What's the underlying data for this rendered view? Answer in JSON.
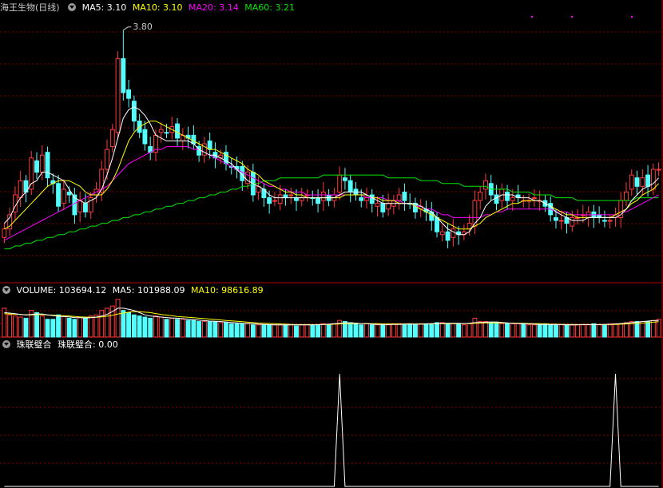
{
  "title": "海王生物(日线)",
  "colors": {
    "up": "#ff3c3c",
    "down": "#54ffff",
    "ma5": "#ffffff",
    "ma10": "#ffff00",
    "ma20": "#ff00ff",
    "ma60": "#00e600",
    "grid": "#8b0000",
    "signal": "#ffffff"
  },
  "price_panel": {
    "legend": [
      {
        "label": "MA5: 3.10",
        "color": "#ffffff"
      },
      {
        "label": "MA10: 3.10",
        "color": "#ffff00"
      },
      {
        "label": "MA20: 3.14",
        "color": "#ff00ff"
      },
      {
        "label": "MA60: 3.21",
        "color": "#00e600"
      }
    ],
    "peak_label": "3.80"
  },
  "volume_panel": {
    "legend": [
      {
        "label": "VOLUME: 103694.12",
        "color": "#ffffff"
      },
      {
        "label": "MA5: 101988.09",
        "color": "#ffffff"
      },
      {
        "label": "MA10: 98616.89",
        "color": "#ffff00"
      }
    ]
  },
  "indicator_panel": {
    "name": "珠联璧合",
    "legend": [
      {
        "label": "珠联璧合: 0.00",
        "color": "#ffffff"
      }
    ]
  },
  "chart_data": [
    {
      "type": "candlestick",
      "title": "海王生物(日线)",
      "x": [
        1,
        2,
        3,
        4,
        5,
        6,
        7,
        8,
        9,
        10,
        11,
        12,
        13,
        14,
        15,
        16,
        17,
        18,
        19,
        20,
        21,
        22,
        23,
        24,
        25,
        26,
        27,
        28,
        29,
        30,
        31,
        32,
        33,
        34,
        35,
        36,
        37,
        38,
        39,
        40,
        41,
        42,
        43,
        44,
        45,
        46,
        47,
        48,
        49,
        50,
        51,
        52,
        53,
        54,
        55,
        56,
        57,
        58,
        59,
        60,
        61,
        62,
        63,
        64,
        65,
        66,
        67,
        68,
        69,
        70,
        71,
        72,
        73,
        74,
        75,
        76,
        77,
        78,
        79,
        80,
        81,
        82,
        83,
        84,
        85,
        86,
        87,
        88,
        89,
        90,
        91,
        92,
        93,
        94,
        95,
        96,
        97,
        98,
        99,
        100,
        101,
        102,
        103,
        104,
        105,
        106,
        107,
        108,
        109,
        110,
        111,
        112,
        113,
        114,
        115,
        116,
        117,
        118,
        119,
        120,
        121,
        122,
        123,
        124,
        125,
        126,
        127,
        128,
        129,
        130,
        131,
        132,
        133,
        134,
        135,
        136,
        137,
        138
      ],
      "closes": [
        3.1,
        3.15,
        3.22,
        3.27,
        3.23,
        3.35,
        3.3,
        3.36,
        3.28,
        3.26,
        3.18,
        3.24,
        3.22,
        3.15,
        3.2,
        3.16,
        3.21,
        3.24,
        3.31,
        3.38,
        3.45,
        3.7,
        3.58,
        3.56,
        3.48,
        3.44,
        3.4,
        3.37,
        3.43,
        3.45,
        3.44,
        3.46,
        3.42,
        3.43,
        3.42,
        3.4,
        3.36,
        3.4,
        3.38,
        3.35,
        3.36,
        3.33,
        3.32,
        3.31,
        3.27,
        3.3,
        3.22,
        3.25,
        3.21,
        3.19,
        3.2,
        3.22,
        3.21,
        3.22,
        3.2,
        3.21,
        3.22,
        3.21,
        3.19,
        3.23,
        3.2,
        3.22,
        3.29,
        3.27,
        3.23,
        3.22,
        3.2,
        3.21,
        3.19,
        3.19,
        3.16,
        3.19,
        3.2,
        3.22,
        3.2,
        3.19,
        3.16,
        3.18,
        3.16,
        3.13,
        3.09,
        3.09,
        3.06,
        3.1,
        3.08,
        3.09,
        3.12,
        3.2,
        3.23,
        3.27,
        3.22,
        3.19,
        3.24,
        3.2,
        3.21,
        3.21,
        3.2,
        3.2,
        3.21,
        3.2,
        3.18,
        3.15,
        3.13,
        3.13,
        3.12,
        3.14,
        3.14,
        3.15,
        3.16,
        3.14,
        3.14,
        3.13,
        3.13,
        3.15,
        3.2,
        3.23,
        3.29,
        3.25,
        3.28,
        3.25,
        3.31,
        3.31
      ],
      "ma5": [
        3.12,
        3.14,
        3.18,
        3.21,
        3.23,
        3.26,
        3.27,
        3.3,
        3.3,
        3.29,
        3.28,
        3.27,
        3.24,
        3.21,
        3.2,
        3.19,
        3.2,
        3.21,
        3.24,
        3.29,
        3.35,
        3.42,
        3.49,
        3.52,
        3.53,
        3.52,
        3.5,
        3.47,
        3.43,
        3.42,
        3.41,
        3.41,
        3.41,
        3.41,
        3.41,
        3.4,
        3.38,
        3.37,
        3.36,
        3.36,
        3.35,
        3.34,
        3.33,
        3.31,
        3.29,
        3.27,
        3.26,
        3.25,
        3.24,
        3.22,
        3.21,
        3.21,
        3.21,
        3.21,
        3.21,
        3.21,
        3.21,
        3.21,
        3.21,
        3.21,
        3.21,
        3.21,
        3.22,
        3.23,
        3.23,
        3.23,
        3.23,
        3.22,
        3.21,
        3.2,
        3.19,
        3.19,
        3.19,
        3.19,
        3.19,
        3.19,
        3.19,
        3.18,
        3.17,
        3.16,
        3.14,
        3.12,
        3.1,
        3.09,
        3.08,
        3.08,
        3.09,
        3.12,
        3.14,
        3.18,
        3.2,
        3.21,
        3.22,
        3.22,
        3.22,
        3.21,
        3.21,
        3.21,
        3.2,
        3.2,
        3.19,
        3.18,
        3.16,
        3.15,
        3.14,
        3.13,
        3.13,
        3.13,
        3.14,
        3.14,
        3.14,
        3.14,
        3.14,
        3.14,
        3.15,
        3.17,
        3.2,
        3.22,
        3.24,
        3.25,
        3.26,
        3.28
      ],
      "ma10": [
        3.1,
        3.11,
        3.13,
        3.15,
        3.17,
        3.19,
        3.21,
        3.23,
        3.25,
        3.26,
        3.27,
        3.27,
        3.27,
        3.26,
        3.25,
        3.23,
        3.22,
        3.22,
        3.22,
        3.24,
        3.27,
        3.31,
        3.36,
        3.41,
        3.44,
        3.46,
        3.47,
        3.48,
        3.48,
        3.47,
        3.46,
        3.45,
        3.44,
        3.43,
        3.42,
        3.41,
        3.4,
        3.39,
        3.38,
        3.38,
        3.37,
        3.36,
        3.35,
        3.34,
        3.33,
        3.31,
        3.3,
        3.29,
        3.27,
        3.26,
        3.25,
        3.24,
        3.23,
        3.23,
        3.22,
        3.22,
        3.21,
        3.21,
        3.21,
        3.21,
        3.21,
        3.21,
        3.21,
        3.22,
        3.22,
        3.22,
        3.22,
        3.22,
        3.21,
        3.21,
        3.2,
        3.2,
        3.2,
        3.19,
        3.19,
        3.19,
        3.18,
        3.17,
        3.16,
        3.15,
        3.14,
        3.13,
        3.12,
        3.11,
        3.1,
        3.1,
        3.1,
        3.11,
        3.12,
        3.14,
        3.15,
        3.16,
        3.17,
        3.18,
        3.19,
        3.19,
        3.2,
        3.2,
        3.2,
        3.2,
        3.19,
        3.18,
        3.17,
        3.16,
        3.15,
        3.15,
        3.14,
        3.14,
        3.14,
        3.14,
        3.14,
        3.14,
        3.14,
        3.15,
        3.16,
        3.17,
        3.19,
        3.2,
        3.22,
        3.23,
        3.24,
        3.26
      ],
      "ma20": [
        3.06,
        3.07,
        3.08,
        3.09,
        3.1,
        3.11,
        3.12,
        3.13,
        3.14,
        3.15,
        3.16,
        3.17,
        3.18,
        3.19,
        3.2,
        3.21,
        3.22,
        3.23,
        3.24,
        3.25,
        3.27,
        3.29,
        3.31,
        3.33,
        3.34,
        3.35,
        3.36,
        3.37,
        3.38,
        3.38,
        3.39,
        3.39,
        3.39,
        3.39,
        3.39,
        3.38,
        3.38,
        3.37,
        3.36,
        3.35,
        3.34,
        3.33,
        3.32,
        3.31,
        3.3,
        3.29,
        3.28,
        3.27,
        3.26,
        3.25,
        3.25,
        3.24,
        3.24,
        3.23,
        3.23,
        3.23,
        3.22,
        3.22,
        3.22,
        3.22,
        3.22,
        3.22,
        3.22,
        3.22,
        3.22,
        3.22,
        3.22,
        3.21,
        3.21,
        3.21,
        3.21,
        3.2,
        3.2,
        3.2,
        3.19,
        3.19,
        3.18,
        3.18,
        3.17,
        3.17,
        3.16,
        3.15,
        3.15,
        3.14,
        3.14,
        3.14,
        3.14,
        3.14,
        3.14,
        3.15,
        3.15,
        3.16,
        3.16,
        3.17,
        3.17,
        3.17,
        3.17,
        3.17,
        3.17,
        3.17,
        3.17,
        3.17,
        3.16,
        3.16,
        3.16,
        3.15,
        3.15,
        3.15,
        3.15,
        3.15,
        3.15,
        3.15,
        3.15,
        3.15,
        3.16,
        3.16,
        3.17,
        3.18,
        3.19,
        3.2,
        3.21,
        3.22
      ],
      "ma60": [
        3.03,
        3.03,
        3.04,
        3.04,
        3.05,
        3.05,
        3.06,
        3.06,
        3.07,
        3.07,
        3.08,
        3.08,
        3.09,
        3.09,
        3.1,
        3.1,
        3.11,
        3.11,
        3.12,
        3.12,
        3.13,
        3.13,
        3.14,
        3.14,
        3.15,
        3.15,
        3.16,
        3.16,
        3.17,
        3.17,
        3.18,
        3.18,
        3.19,
        3.19,
        3.2,
        3.2,
        3.21,
        3.21,
        3.22,
        3.22,
        3.23,
        3.23,
        3.24,
        3.24,
        3.25,
        3.25,
        3.26,
        3.26,
        3.27,
        3.27,
        3.27,
        3.28,
        3.28,
        3.28,
        3.28,
        3.28,
        3.28,
        3.28,
        3.28,
        3.29,
        3.29,
        3.29,
        3.29,
        3.29,
        3.29,
        3.29,
        3.29,
        3.29,
        3.29,
        3.29,
        3.29,
        3.28,
        3.28,
        3.28,
        3.28,
        3.28,
        3.28,
        3.27,
        3.27,
        3.27,
        3.27,
        3.26,
        3.26,
        3.26,
        3.26,
        3.25,
        3.25,
        3.25,
        3.25,
        3.25,
        3.24,
        3.24,
        3.24,
        3.24,
        3.23,
        3.23,
        3.23,
        3.23,
        3.22,
        3.22,
        3.22,
        3.22,
        3.21,
        3.21,
        3.21,
        3.21,
        3.2,
        3.2,
        3.2,
        3.2,
        3.2,
        3.2,
        3.2,
        3.2,
        3.2,
        3.2,
        3.2,
        3.21,
        3.21,
        3.21,
        3.21,
        3.21
      ],
      "ylim": [
        2.95,
        3.85
      ],
      "peak": {
        "index": 22,
        "value": 3.8
      }
    },
    {
      "type": "bar",
      "title": "VOLUME",
      "values": [
        130,
        100,
        95,
        90,
        85,
        120,
        110,
        95,
        80,
        80,
        100,
        95,
        85,
        80,
        90,
        85,
        95,
        100,
        120,
        130,
        140,
        170,
        120,
        110,
        100,
        95,
        90,
        85,
        95,
        90,
        80,
        85,
        80,
        80,
        75,
        75,
        70,
        70,
        70,
        70,
        65,
        65,
        60,
        60,
        60,
        60,
        55,
        55,
        55,
        55,
        55,
        55,
        55,
        55,
        50,
        55,
        55,
        55,
        55,
        60,
        55,
        60,
        75,
        70,
        65,
        60,
        55,
        60,
        55,
        55,
        55,
        55,
        60,
        60,
        55,
        60,
        55,
        60,
        60,
        60,
        65,
        65,
        60,
        60,
        60,
        55,
        60,
        85,
        70,
        70,
        65,
        65,
        60,
        60,
        60,
        60,
        60,
        55,
        55,
        55,
        60,
        55,
        55,
        55,
        55,
        55,
        55,
        55,
        55,
        60,
        55,
        55,
        55,
        60,
        60,
        65,
        70,
        70,
        70,
        70,
        75,
        80
      ],
      "ma5": [
        110,
        108,
        105,
        102,
        100,
        102,
        104,
        104,
        100,
        97,
        94,
        92,
        91,
        88,
        87,
        86,
        87,
        90,
        95,
        102,
        115,
        130,
        130,
        125,
        120,
        110,
        100,
        95,
        92,
        90,
        88,
        86,
        85,
        83,
        80,
        78,
        76,
        74,
        72,
        71,
        70,
        68,
        66,
        64,
        62,
        61,
        60,
        58,
        57,
        56,
        55,
        55,
        55,
        55,
        55,
        55,
        55,
        55,
        56,
        57,
        58,
        60,
        62,
        64,
        64,
        63,
        61,
        60,
        58,
        57,
        57,
        56,
        57,
        57,
        58,
        58,
        58,
        58,
        59,
        60,
        61,
        62,
        62,
        62,
        62,
        60,
        62,
        65,
        66,
        67,
        68,
        68,
        66,
        64,
        62,
        61,
        60,
        59,
        58,
        57,
        57,
        56,
        56,
        56,
        55,
        55,
        55,
        56,
        56,
        56,
        56,
        57,
        58,
        59,
        61,
        63,
        65,
        67,
        70,
        72,
        74,
        75
      ],
      "ma10": [
        105,
        104,
        103,
        102,
        100,
        100,
        101,
        101,
        100,
        99,
        97,
        96,
        95,
        93,
        91,
        90,
        89,
        89,
        91,
        94,
        98,
        104,
        108,
        112,
        115,
        114,
        112,
        110,
        106,
        102,
        99,
        96,
        93,
        91,
        89,
        87,
        85,
        83,
        81,
        79,
        77,
        75,
        73,
        71,
        69,
        67,
        65,
        63,
        62,
        61,
        60,
        59,
        58,
        57,
        56,
        56,
        56,
        56,
        56,
        57,
        57,
        58,
        59,
        60,
        61,
        61,
        61,
        61,
        60,
        60,
        59,
        59,
        59,
        59,
        59,
        59,
        59,
        59,
        59,
        59,
        60,
        60,
        60,
        61,
        61,
        61,
        61,
        62,
        63,
        64,
        64,
        64,
        64,
        63,
        63,
        62,
        62,
        61,
        60,
        60,
        59,
        58,
        58,
        57,
        57,
        57,
        56,
        56,
        56,
        56,
        56,
        56,
        57,
        57,
        58,
        59,
        60,
        62,
        63,
        65,
        67,
        69
      ],
      "ylim": [
        0,
        180
      ]
    },
    {
      "type": "line",
      "title": "珠联璧合",
      "values": [
        0,
        0,
        0,
        0,
        0,
        0,
        0,
        0,
        0,
        0,
        0,
        0,
        0,
        0,
        0,
        0,
        0,
        0,
        0,
        0,
        0,
        0,
        0,
        0,
        0,
        0,
        0,
        0,
        0,
        0,
        0,
        0,
        0,
        0,
        0,
        0,
        0,
        0,
        0,
        0,
        0,
        0,
        0,
        0,
        0,
        0,
        0,
        0,
        0,
        0,
        0,
        0,
        0,
        0,
        0,
        0,
        0,
        0,
        0,
        0,
        0,
        0,
        1,
        0,
        0,
        0,
        0,
        0,
        0,
        0,
        0,
        0,
        0,
        0,
        0,
        0,
        0,
        0,
        0,
        0,
        0,
        0,
        0,
        0,
        0,
        0,
        0,
        0,
        0,
        0,
        0,
        0,
        0,
        0,
        0,
        0,
        0,
        0,
        0,
        0,
        0,
        0,
        0,
        0,
        0,
        0,
        0,
        0,
        0,
        0,
        0,
        0,
        0,
        1,
        0,
        0,
        0,
        0,
        0,
        0,
        0,
        0
      ],
      "ylim": [
        0,
        1.2
      ]
    }
  ]
}
